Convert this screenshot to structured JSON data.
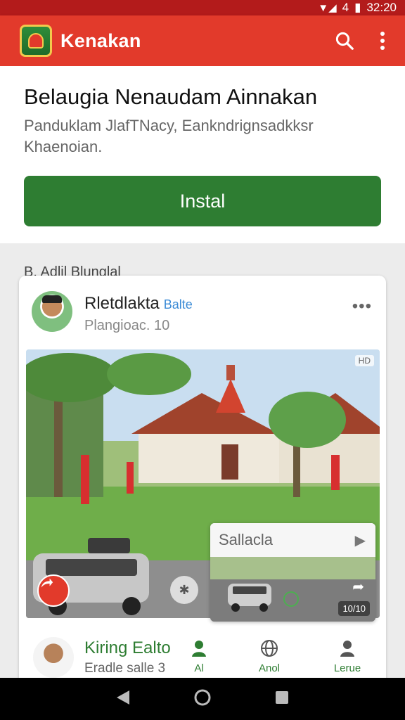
{
  "status_bar": {
    "signal": "4",
    "time": "32:20"
  },
  "app_bar": {
    "title": "Kenakan"
  },
  "app_info": {
    "name": "Belaugia Nenaudam Ainnakan",
    "description": "Panduklam JlafTNacy, Eankndrignsadkksr Khaenoian.",
    "install_label": "Instal"
  },
  "section": {
    "label": "B. Adlil Blunglal"
  },
  "post": {
    "author": "Rletdlakta",
    "author_tag": "Balte",
    "meta": "Plangioac. 10",
    "photo_badge": "HD",
    "mini_player": {
      "title": "Sallacla",
      "counter": "10/10"
    }
  },
  "comment": {
    "name": "Kiring Ealto",
    "meta": "Eradle salle 3",
    "actions": [
      {
        "label": "Al",
        "icon": "person-icon",
        "color": "#2e7d32"
      },
      {
        "label": "Anol",
        "icon": "globe-icon",
        "color": "#2e7d32"
      },
      {
        "label": "Lerue",
        "icon": "user-icon",
        "color": "#2e7d32"
      }
    ]
  }
}
